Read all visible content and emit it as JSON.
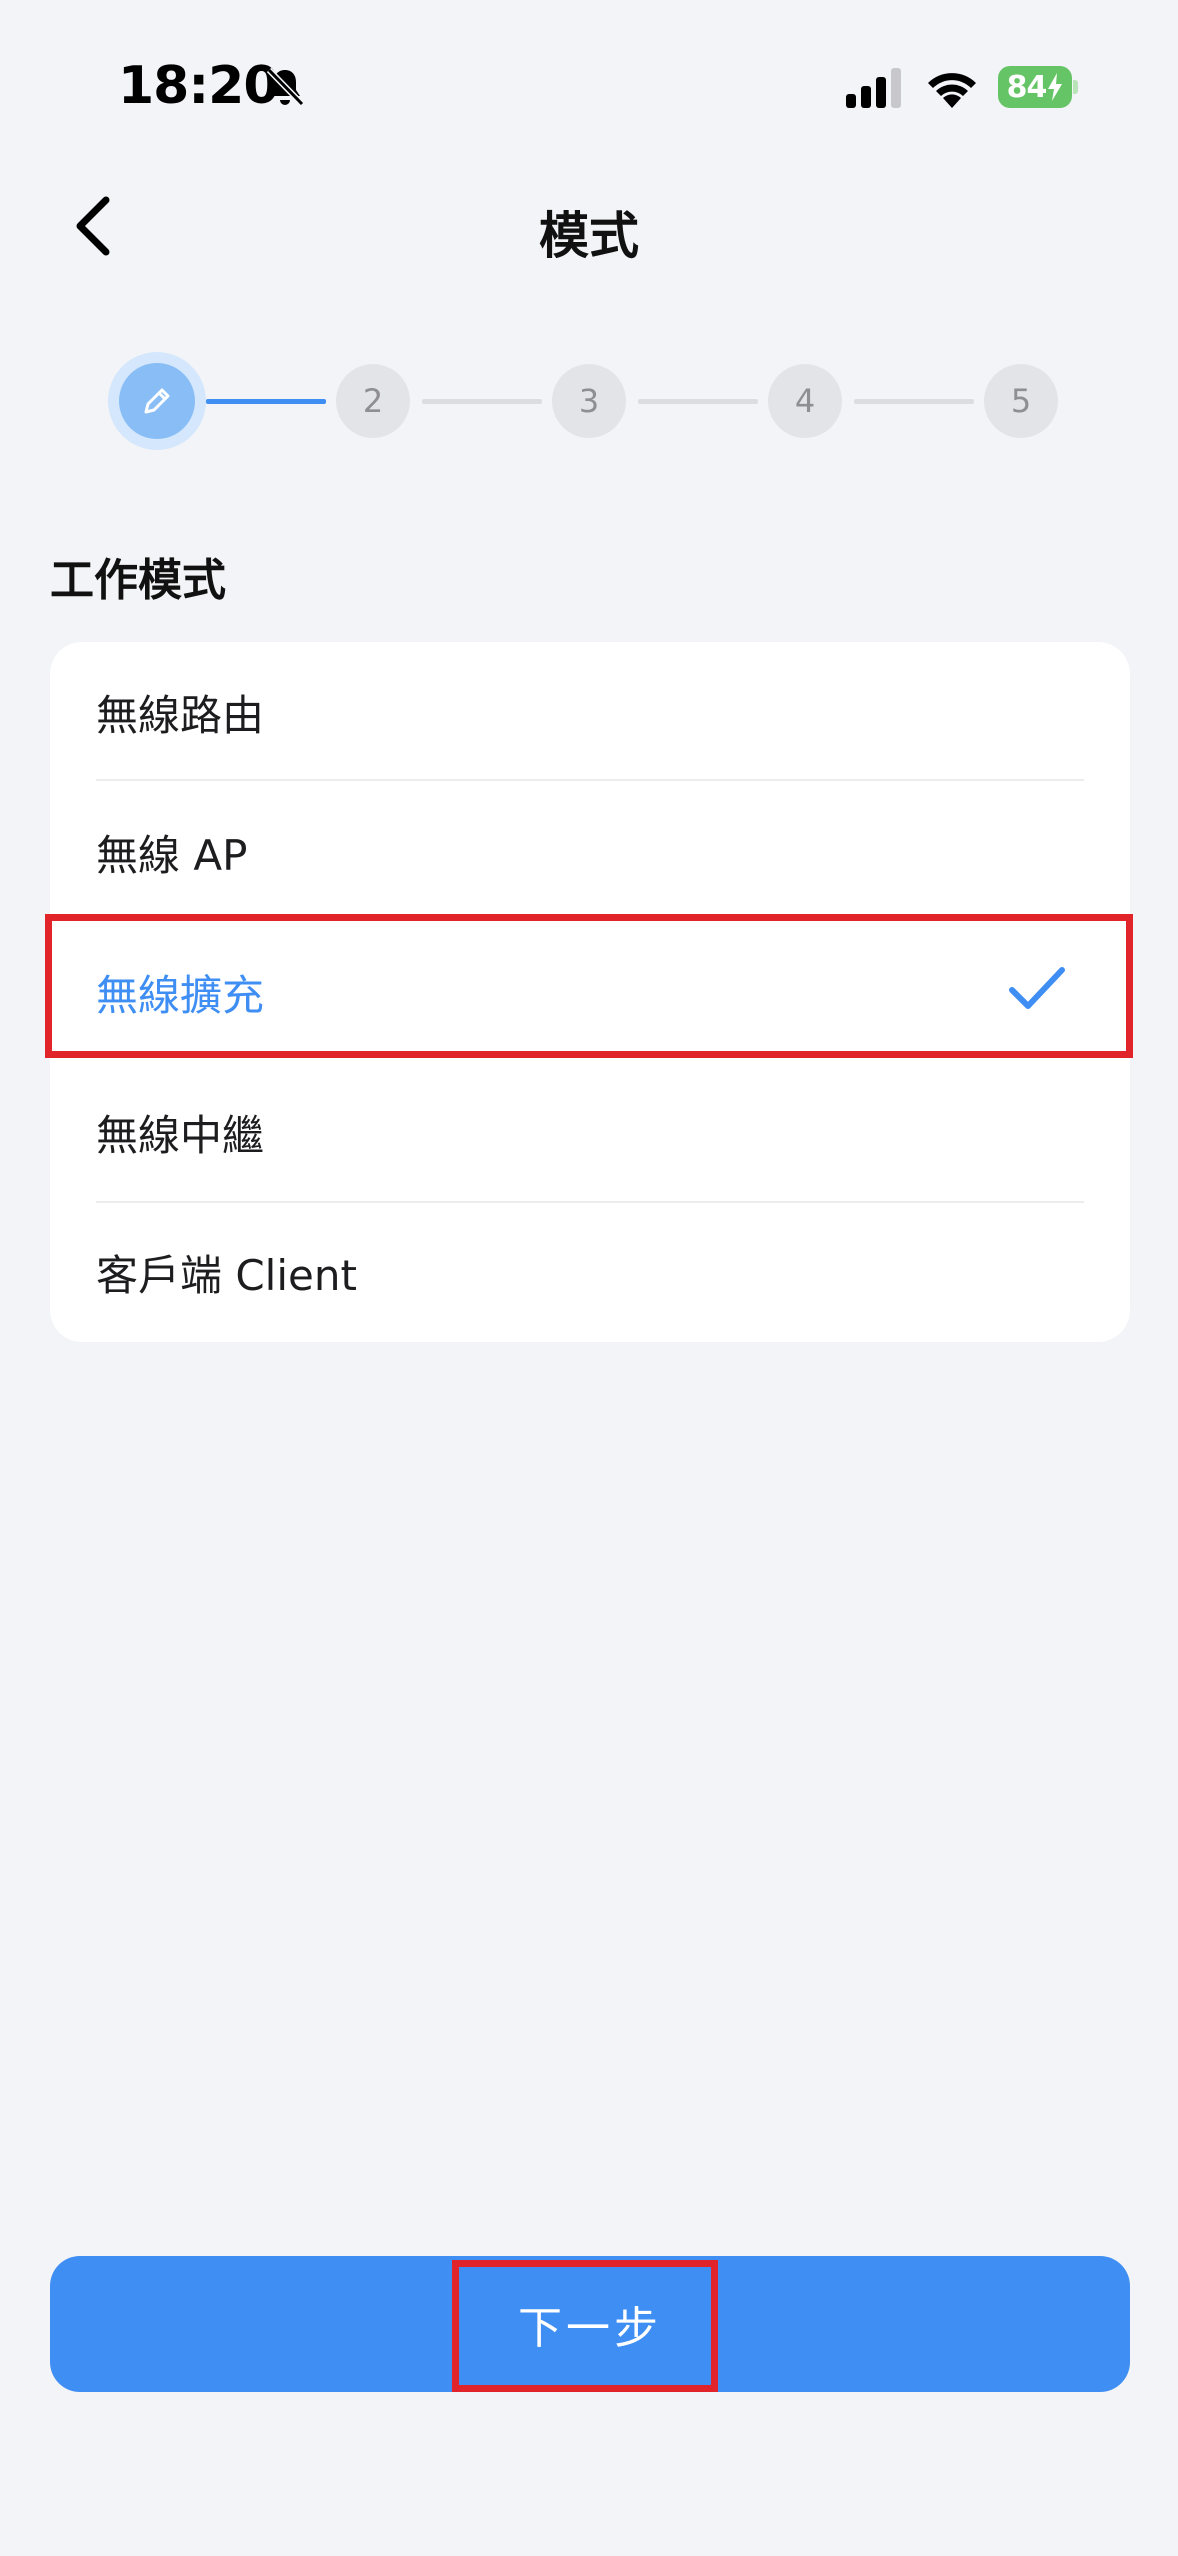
{
  "status_bar": {
    "time": "18:20",
    "battery": "84",
    "icons": [
      "bell-slash-icon",
      "signal-icon",
      "wifi-icon",
      "battery-charging-icon"
    ]
  },
  "nav": {
    "back_icon": "chevron-left-icon",
    "title": "模式"
  },
  "stepper": {
    "current_icon": "pencil-icon",
    "steps": [
      "2",
      "3",
      "4",
      "5"
    ]
  },
  "section": {
    "title": "工作模式"
  },
  "modes": {
    "items": [
      {
        "label": "無線路由"
      },
      {
        "label": "無線 AP"
      },
      {
        "label": "無線擴充"
      },
      {
        "label": "無線中繼"
      },
      {
        "label": "客戶端 Client"
      }
    ],
    "selected": "無線擴充"
  },
  "footer": {
    "next_label": "下一步"
  },
  "colors": {
    "accent": "#3f8ef3",
    "highlight": "#e0242a",
    "background": "#f3f4f7",
    "battery": "#65c466"
  }
}
